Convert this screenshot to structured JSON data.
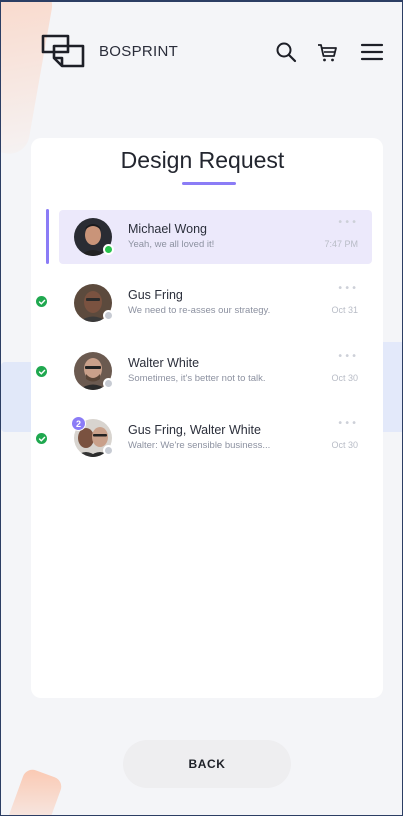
{
  "header": {
    "brand": "BOSPRINT",
    "icons": [
      "logo-icon",
      "search-icon",
      "cart-icon",
      "menu-icon"
    ]
  },
  "page": {
    "title": "Design Request"
  },
  "conversations": [
    {
      "name": "Michael Wong",
      "message": "Yeah, we all loved it!",
      "time": "7:47 PM",
      "active": true,
      "online": true,
      "checked": false
    },
    {
      "name": "Gus Fring",
      "message": "We need to re-asses our strategy.",
      "time": "Oct 31",
      "active": false,
      "online": false,
      "checked": true
    },
    {
      "name": "Walter White",
      "message": "Sometimes, it's better not to talk.",
      "time": "Oct 30",
      "active": false,
      "online": false,
      "checked": true
    },
    {
      "name": "Gus Fring, Walter White",
      "message": "Walter: We're sensible business...",
      "time": "Oct 30",
      "badge": "2",
      "active": false,
      "online": false,
      "checked": true
    }
  ],
  "footer": {
    "back_label": "BACK"
  },
  "colors": {
    "accent": "#8b7cf6",
    "online": "#27c24c",
    "check": "#1fa84f"
  }
}
